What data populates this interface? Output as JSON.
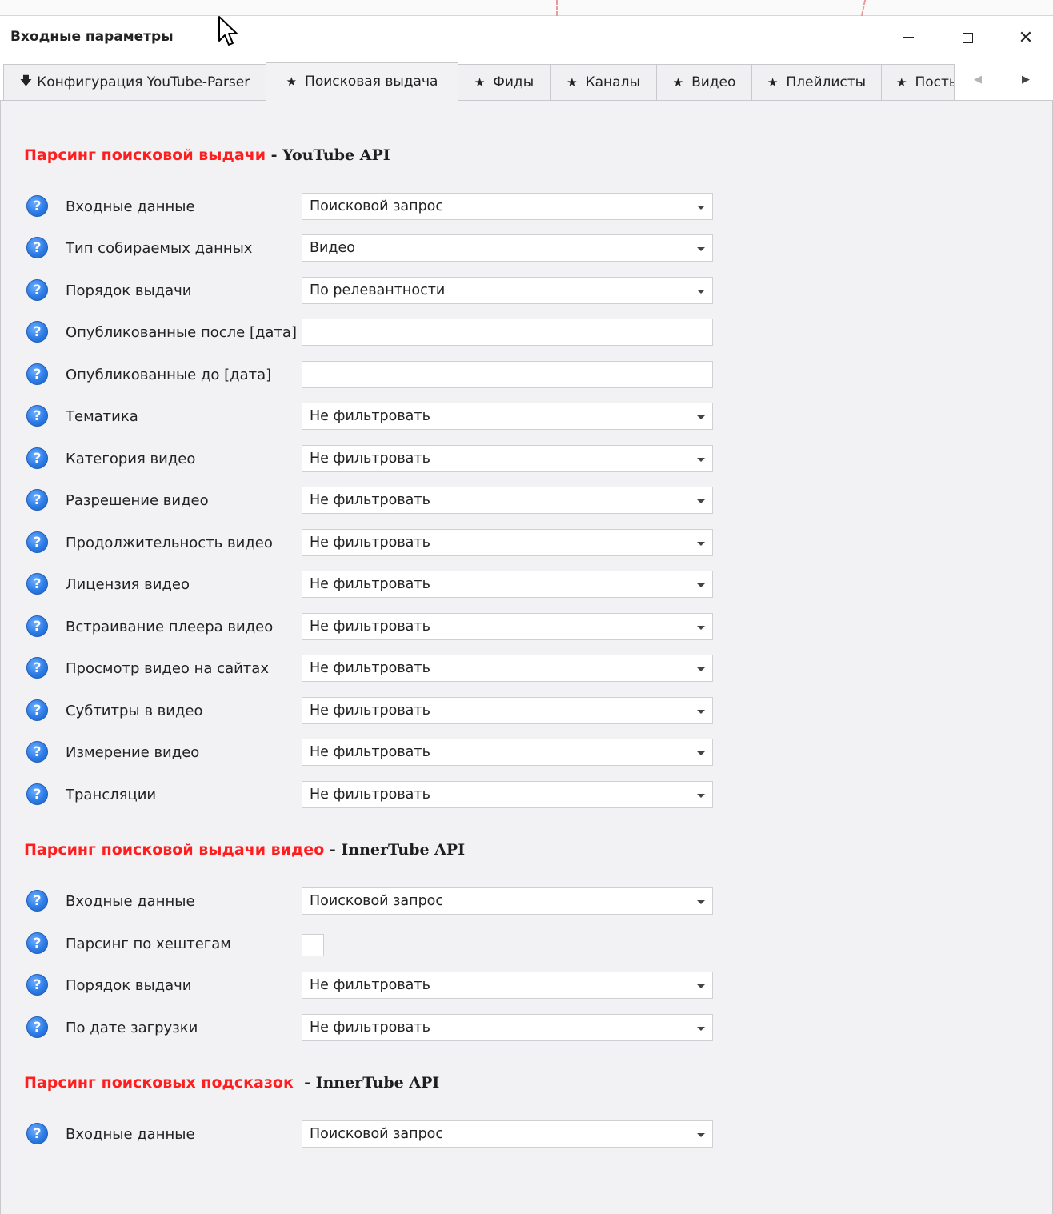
{
  "window": {
    "title": "Входные параметры",
    "controls": {
      "minimize": "—",
      "maximize": "□",
      "close": "✕"
    }
  },
  "tabs": [
    {
      "icon": "download-arrow-icon",
      "glyph": "🡇",
      "label": "Конфигурация YouTube-Parser",
      "active": false
    },
    {
      "icon": "star-icon",
      "glyph": "★",
      "label": "Поисковая выдача",
      "active": true
    },
    {
      "icon": "star-icon",
      "glyph": "★",
      "label": "Фиды",
      "active": false
    },
    {
      "icon": "star-icon",
      "glyph": "★",
      "label": "Каналы",
      "active": false
    },
    {
      "icon": "star-icon",
      "glyph": "★",
      "label": "Видео",
      "active": false
    },
    {
      "icon": "star-icon",
      "glyph": "★",
      "label": "Плейлисты",
      "active": false
    },
    {
      "icon": "star-icon",
      "glyph": "★",
      "label": "Посты",
      "active": false
    }
  ],
  "tab_scroll": {
    "left": "◀",
    "right": "▶"
  },
  "help_glyph": "?",
  "sections": [
    {
      "title_red": "Парсинг поисковой выдачи",
      "title_dark": " - YouTube API",
      "rows": [
        {
          "label": "Входные данные",
          "type": "combo",
          "value": "Поисковой запрос"
        },
        {
          "label": "Тип собираемых данных",
          "type": "combo",
          "value": "Видео"
        },
        {
          "label": "Порядок выдачи",
          "type": "combo",
          "value": "По релевантности"
        },
        {
          "label": "Опубликованные после [дата]",
          "type": "text",
          "value": ""
        },
        {
          "label": "Опубликованные до [дата]",
          "type": "text",
          "value": ""
        },
        {
          "label": "Тематика",
          "type": "combo",
          "value": "Не фильтровать"
        },
        {
          "label": "Категория видео",
          "type": "combo",
          "value": "Не фильтровать"
        },
        {
          "label": "Разрешение видео",
          "type": "combo",
          "value": "Не фильтровать"
        },
        {
          "label": "Продолжительность видео",
          "type": "combo",
          "value": "Не фильтровать"
        },
        {
          "label": "Лицензия видео",
          "type": "combo",
          "value": "Не фильтровать"
        },
        {
          "label": "Встраивание плеера видео",
          "type": "combo",
          "value": "Не фильтровать"
        },
        {
          "label": "Просмотр видео на сайтах",
          "type": "combo",
          "value": "Не фильтровать"
        },
        {
          "label": "Субтитры в видео",
          "type": "combo",
          "value": "Не фильтровать"
        },
        {
          "label": "Измерение видео",
          "type": "combo",
          "value": "Не фильтровать"
        },
        {
          "label": "Трансляции",
          "type": "combo",
          "value": "Не фильтровать"
        }
      ]
    },
    {
      "title_red": "Парсинг поисковой выдачи видео",
      "title_dark": " - InnerTube API",
      "rows": [
        {
          "label": "Входные данные",
          "type": "combo",
          "value": "Поисковой запрос"
        },
        {
          "label": "Парсинг по хештегам",
          "type": "checkbox",
          "checked": false
        },
        {
          "label": "Порядок выдачи",
          "type": "combo",
          "value": "Не фильтровать"
        },
        {
          "label": "По дате загрузки",
          "type": "combo",
          "value": "Не фильтровать"
        }
      ]
    },
    {
      "title_red": "Парсинг поисковых подсказок",
      "title_dark": "  - InnerTube API",
      "rows": [
        {
          "label": "Входные данные",
          "type": "combo",
          "value": "Поисковой запрос"
        }
      ]
    }
  ]
}
